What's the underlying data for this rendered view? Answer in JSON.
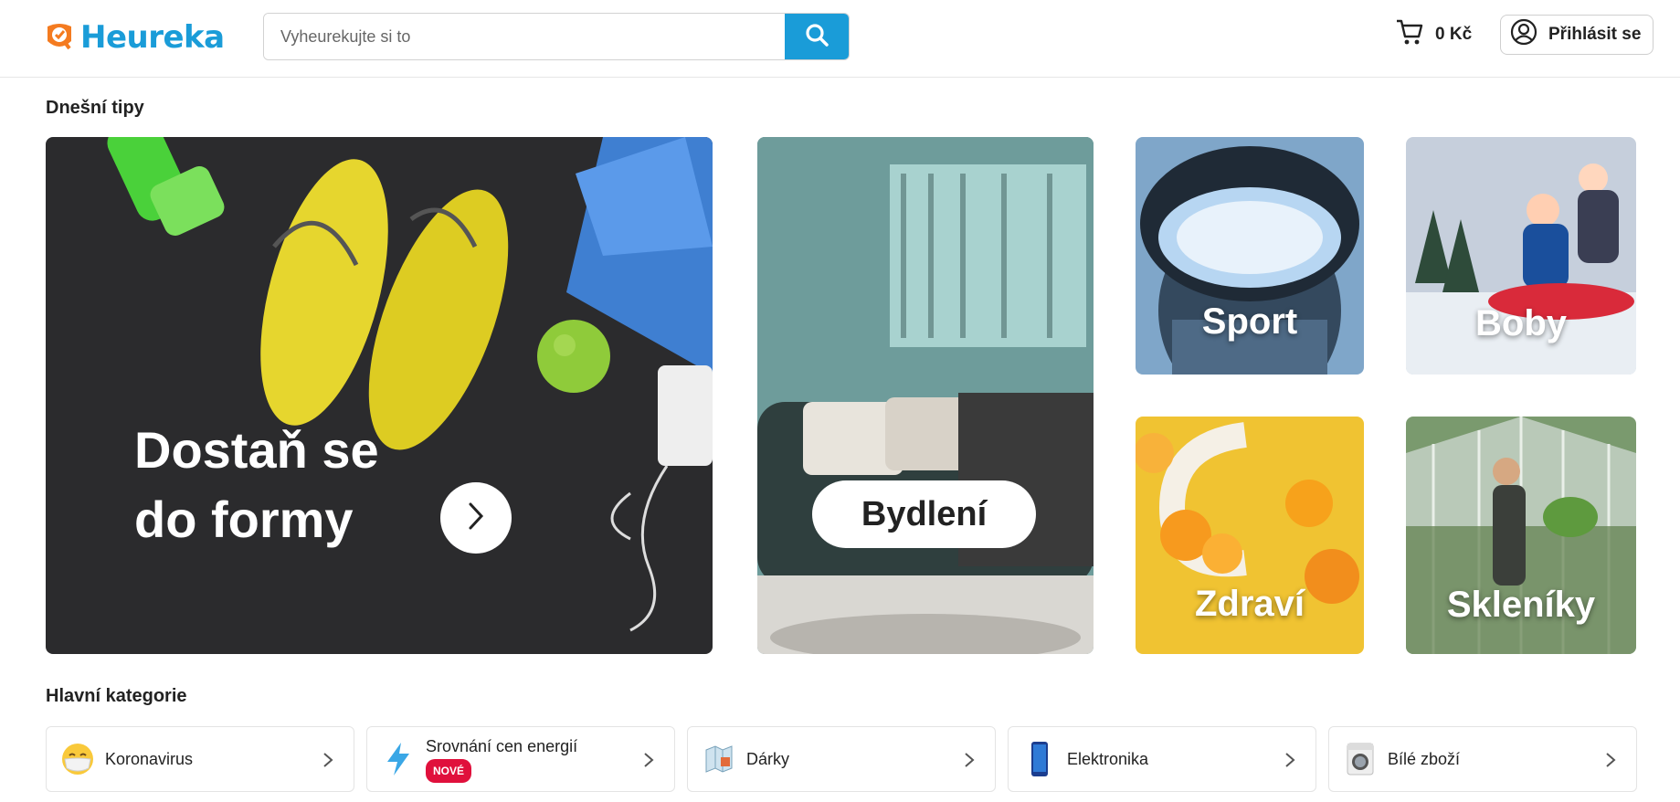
{
  "header": {
    "logo_text": "Heureka",
    "search_placeholder": "Vyheurekujte si to",
    "cart_amount": "0 Kč",
    "login_label": "Přihlásit se"
  },
  "tips": {
    "title": "Dnešní tipy",
    "big_tile": {
      "line1": "Dostaň se",
      "line2": "do formy"
    },
    "items": [
      {
        "label": "Bydlení"
      },
      {
        "label": "Sport"
      },
      {
        "label": "Boby"
      },
      {
        "label": "Zdraví"
      },
      {
        "label": "Skleníky"
      }
    ]
  },
  "categories": {
    "title": "Hlavní kategorie",
    "items": [
      {
        "label": "Koronavirus",
        "icon": "mask-emoji-icon"
      },
      {
        "label": "Srovnání cen energií",
        "badge": "NOVÉ",
        "icon": "lightning-icon"
      },
      {
        "label": "Dárky",
        "icon": "map-gift-icon"
      },
      {
        "label": "Elektronika",
        "icon": "phone-icon"
      },
      {
        "label": "Bílé zboží",
        "icon": "washing-machine-icon"
      }
    ]
  },
  "colors": {
    "brand_blue": "#1a9cd8",
    "brand_orange": "#f47b20",
    "badge_red": "#e0103c"
  }
}
